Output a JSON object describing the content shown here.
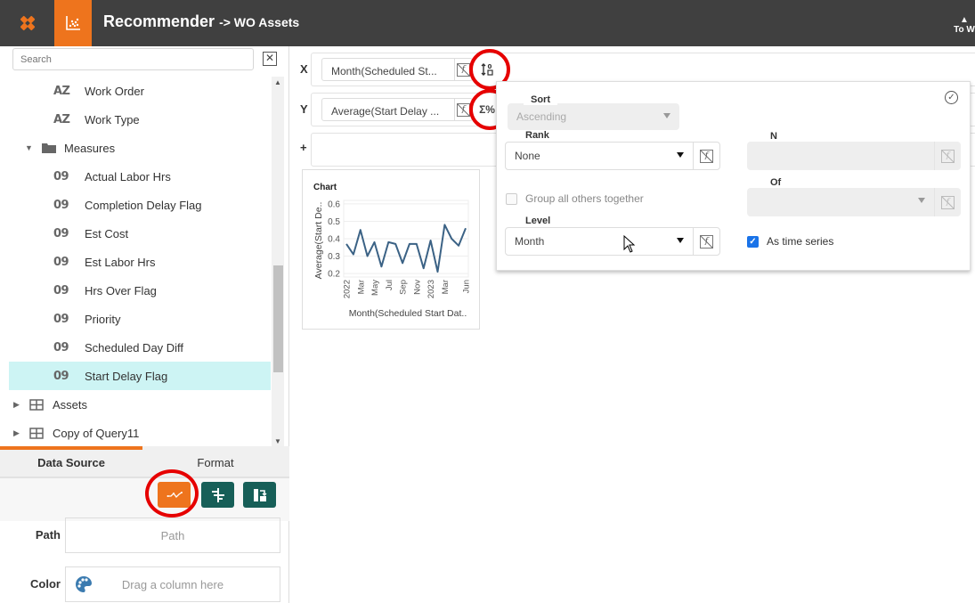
{
  "header": {
    "app_title": "Recommender",
    "app_subtitle": "-> WO Assets",
    "right_action_label": "To W"
  },
  "sidebar": {
    "search": {
      "placeholder": "Search",
      "value": ""
    },
    "tree": [
      {
        "type": "text",
        "icon": "AZ",
        "label": "Work Order"
      },
      {
        "type": "text",
        "icon": "AZ",
        "label": "Work Type"
      },
      {
        "type": "folder",
        "icon": "folder",
        "label": "Measures",
        "expanded": true
      },
      {
        "type": "number",
        "icon": "09",
        "label": "Actual Labor Hrs"
      },
      {
        "type": "number",
        "icon": "09",
        "label": "Completion Delay Flag"
      },
      {
        "type": "number",
        "icon": "09",
        "label": "Est Cost"
      },
      {
        "type": "number",
        "icon": "09",
        "label": "Est Labor Hrs"
      },
      {
        "type": "number",
        "icon": "09",
        "label": "Hrs Over Flag"
      },
      {
        "type": "number",
        "icon": "09",
        "label": "Priority"
      },
      {
        "type": "number",
        "icon": "09",
        "label": "Scheduled Day Diff"
      },
      {
        "type": "number",
        "icon": "09",
        "label": "Start Delay Flag",
        "selected": true
      },
      {
        "type": "table",
        "icon": "table",
        "label": "Assets"
      },
      {
        "type": "table",
        "icon": "table",
        "label": "Copy of Query11"
      }
    ],
    "tabs": [
      {
        "label": "Data Source",
        "active": true
      },
      {
        "label": "Format",
        "active": false
      }
    ],
    "viz_buttons": [
      {
        "name": "line-path",
        "active": true
      },
      {
        "name": "sort-bars",
        "active": false
      },
      {
        "name": "swap-axes",
        "active": false
      }
    ],
    "encodings": [
      {
        "label": "Path",
        "placeholder": "Path"
      },
      {
        "label": "Color",
        "placeholder": "Drag a column here"
      }
    ]
  },
  "shelves": {
    "x": {
      "label": "X",
      "pill": "Month(Scheduled St...",
      "action": "sort-icon"
    },
    "y": {
      "label": "Y",
      "pill": "Average(Start Delay ...",
      "action": "sigma-percent-icon"
    },
    "add": {
      "label": "+"
    }
  },
  "popover": {
    "sort": {
      "label": "Sort",
      "value": "Ascending",
      "disabled": true
    },
    "rank": {
      "label": "Rank",
      "value": "None"
    },
    "n": {
      "label": "N",
      "value": "",
      "disabled": true
    },
    "group_others": {
      "label": "Group all others together",
      "checked": false,
      "disabled": true
    },
    "of": {
      "label": "Of",
      "value": "",
      "disabled": true
    },
    "level": {
      "label": "Level",
      "value": "Month"
    },
    "as_time_series": {
      "label": "As time series",
      "checked": true
    }
  },
  "chart_data": {
    "type": "line",
    "title": "Chart",
    "xlabel": "Month(Scheduled Start Dat..",
    "ylabel": "Average(Start De..",
    "x": [
      "2022-01",
      "2022-02",
      "2022-03",
      "2022-04",
      "2022-05",
      "2022-06",
      "2022-07",
      "2022-08",
      "2022-09",
      "2022-10",
      "2022-11",
      "2022-12",
      "2023-01",
      "2023-02",
      "2023-03",
      "2023-04",
      "2023-05",
      "2023-06"
    ],
    "x_tick_labels": [
      {
        "index": 0,
        "label": "2022"
      },
      {
        "index": 2,
        "label": "Mar"
      },
      {
        "index": 4,
        "label": "May"
      },
      {
        "index": 6,
        "label": "Jul"
      },
      {
        "index": 8,
        "label": "Sep"
      },
      {
        "index": 10,
        "label": "Nov"
      },
      {
        "index": 12,
        "label": "2023"
      },
      {
        "index": 14,
        "label": "Mar"
      },
      {
        "index": 17,
        "label": "Jun"
      }
    ],
    "series": [
      {
        "name": "Average(Start Delay Flag)",
        "color": "#3b6285",
        "values": [
          0.37,
          0.31,
          0.45,
          0.3,
          0.38,
          0.24,
          0.38,
          0.37,
          0.26,
          0.37,
          0.37,
          0.23,
          0.39,
          0.21,
          0.48,
          0.4,
          0.36,
          0.46
        ]
      }
    ],
    "yticks": [
      0.2,
      0.3,
      0.4,
      0.5,
      0.6
    ],
    "ylim": [
      0.18,
      0.62
    ],
    "grid": true,
    "legend": "none"
  },
  "colors": {
    "brand_orange": "#ee741d",
    "teal_button": "#175f58",
    "selected_row": "#cdf4f4",
    "highlight_ring": "#e60000"
  }
}
